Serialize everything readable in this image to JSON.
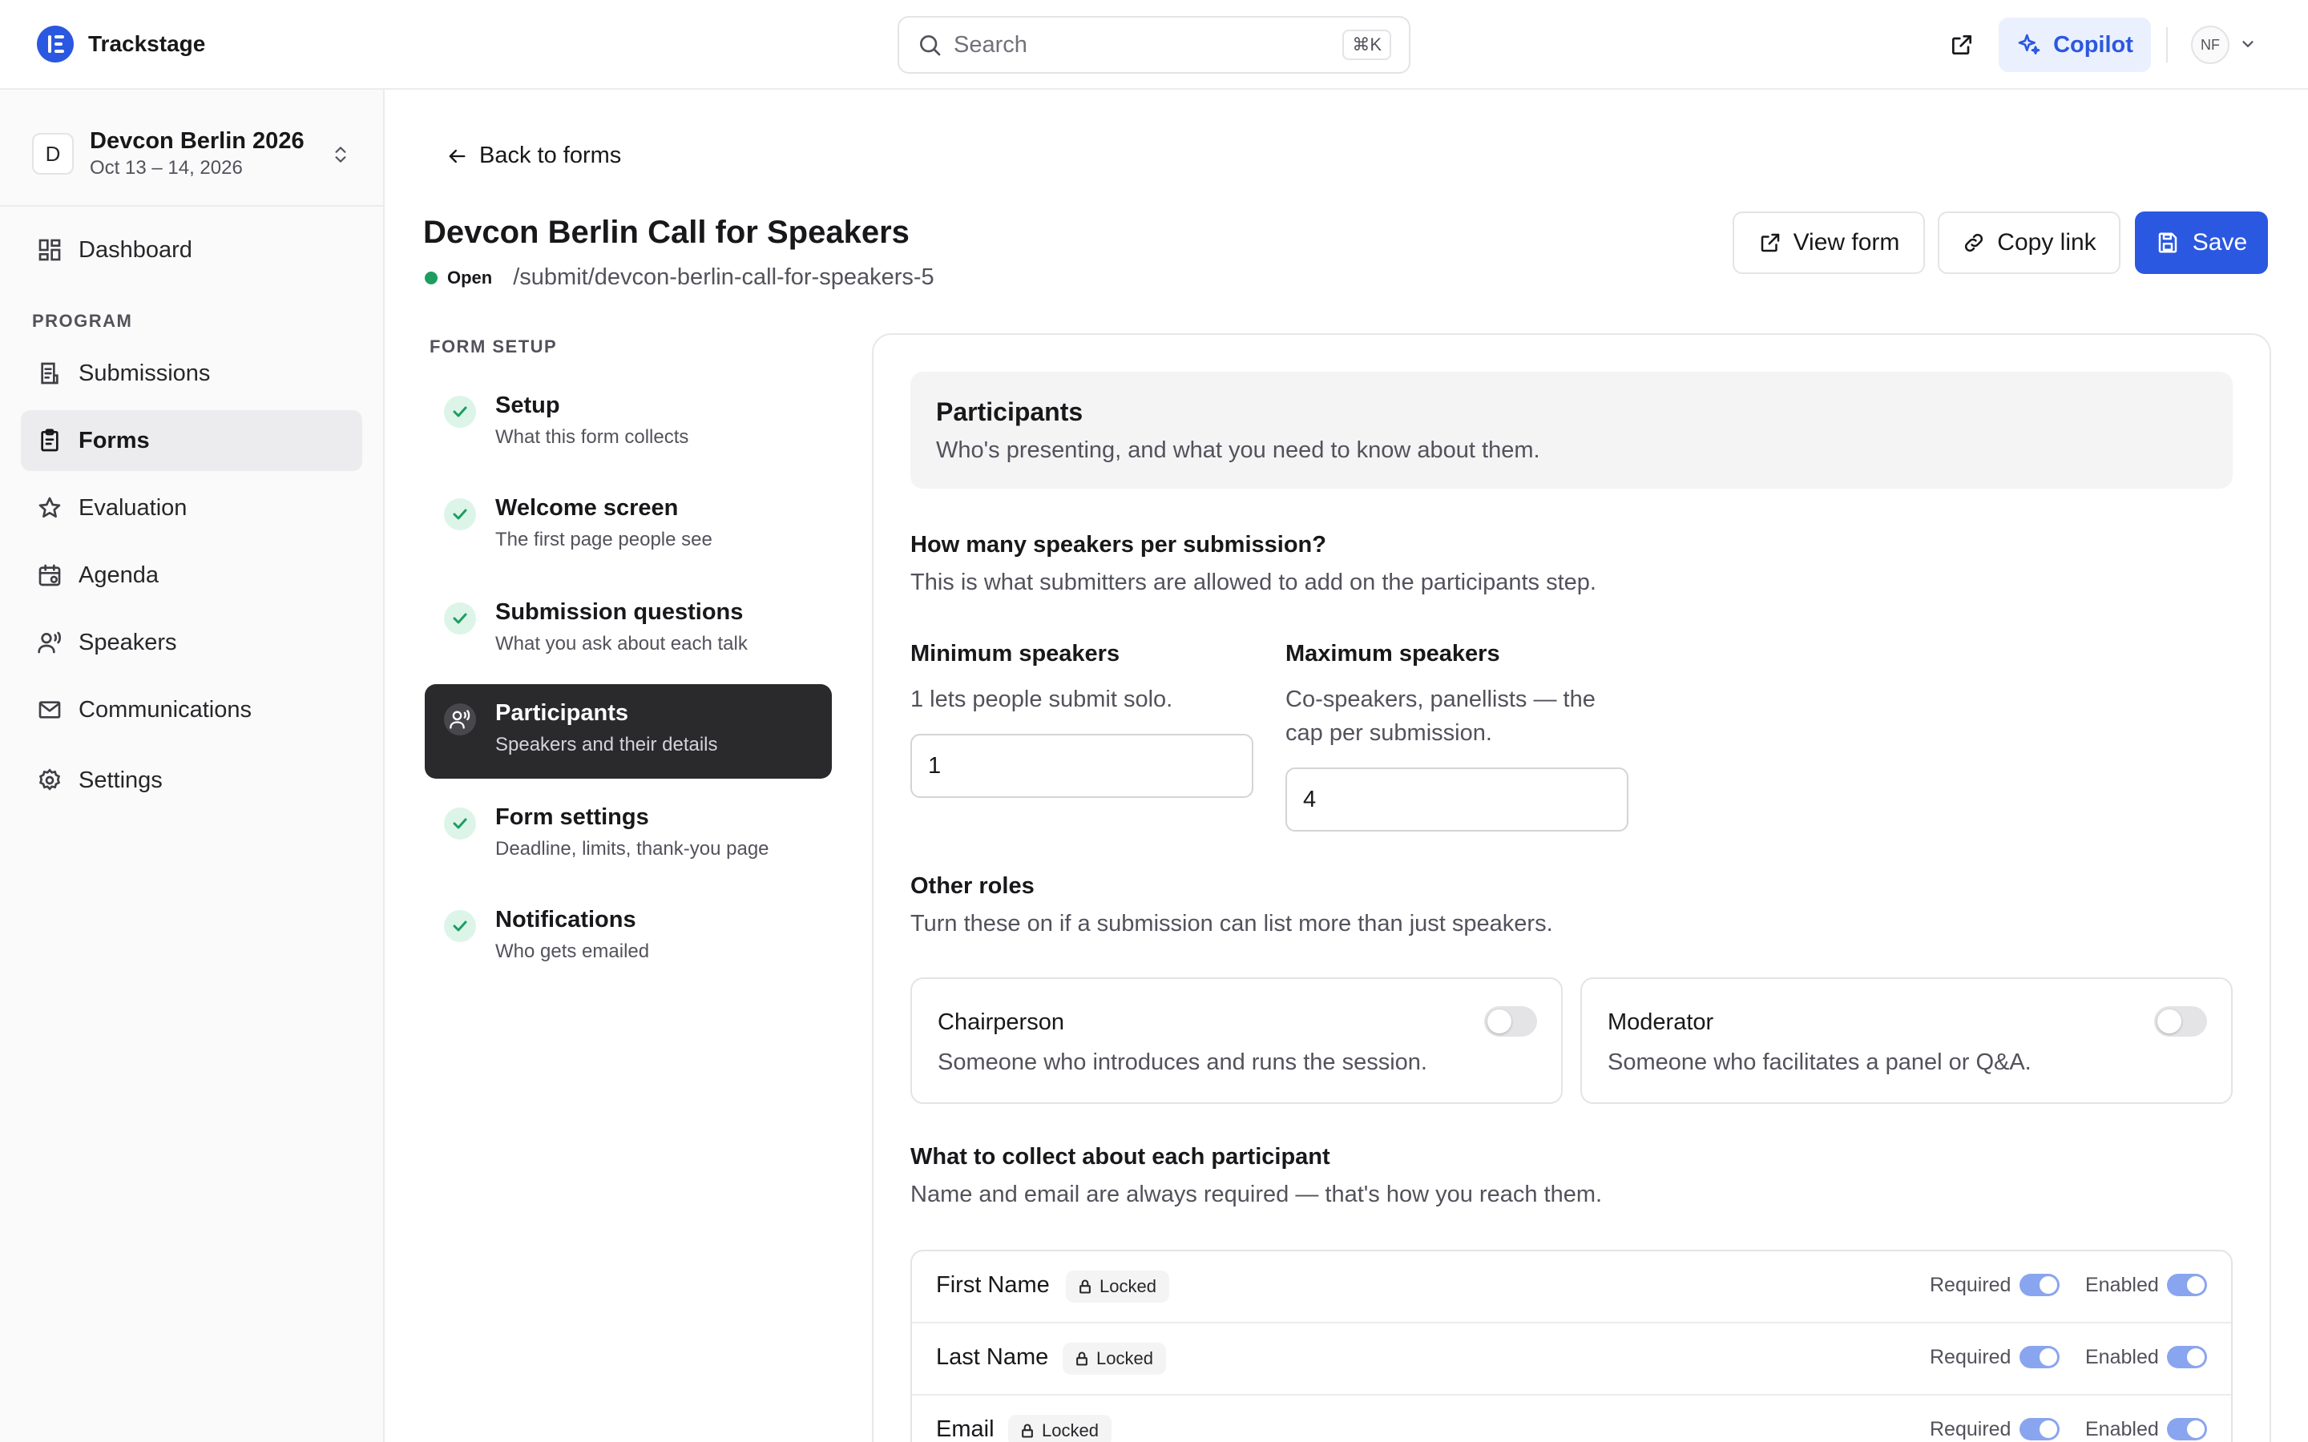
{
  "app": {
    "name": "Trackstage"
  },
  "search": {
    "placeholder": "Search",
    "shortcut": "⌘K"
  },
  "header": {
    "copilot_label": "Copilot",
    "user_initials": "NF"
  },
  "event": {
    "initial": "D",
    "name": "Devcon Berlin 2026",
    "dates": "Oct 13 – 14, 2026"
  },
  "sidebar": {
    "dashboard": "Dashboard",
    "section_label": "PROGRAM",
    "items": [
      {
        "label": "Submissions",
        "icon": "submissions-icon"
      },
      {
        "label": "Forms",
        "icon": "clipboard-icon",
        "active": true
      },
      {
        "label": "Evaluation",
        "icon": "star-icon"
      },
      {
        "label": "Agenda",
        "icon": "calendar-icon"
      },
      {
        "label": "Speakers",
        "icon": "speaker-icon"
      },
      {
        "label": "Communications",
        "icon": "mail-icon"
      },
      {
        "label": "Settings",
        "icon": "gear-icon"
      }
    ]
  },
  "page": {
    "back_label": "Back to forms",
    "title": "Devcon Berlin Call for Speakers",
    "status": "Open",
    "status_color": "#1f9d61",
    "url": "/submit/devcon-berlin-call-for-speakers-5",
    "view_form": "View form",
    "copy_link": "Copy link",
    "save": "Save"
  },
  "steps": {
    "label": "FORM SETUP",
    "items": [
      {
        "title": "Setup",
        "subtitle": "What this form collects",
        "state": "complete"
      },
      {
        "title": "Welcome screen",
        "subtitle": "The first page people see",
        "state": "complete"
      },
      {
        "title": "Submission questions",
        "subtitle": "What you ask about each talk",
        "state": "complete"
      },
      {
        "title": "Participants",
        "subtitle": "Speakers and their details",
        "state": "active"
      },
      {
        "title": "Form settings",
        "subtitle": "Deadline, limits, thank-you page",
        "state": "complete"
      },
      {
        "title": "Notifications",
        "subtitle": "Who gets emailed",
        "state": "complete"
      }
    ]
  },
  "panel": {
    "title": "Participants",
    "subtitle": "Who's presenting, and what you need to know about them.",
    "speakers_q": {
      "title": "How many speakers per submission?",
      "subtitle": "This is what submitters are allowed to add on the participants step."
    },
    "min": {
      "label": "Minimum speakers",
      "help": "1 lets people submit solo.",
      "value": "1"
    },
    "max": {
      "label": "Maximum speakers",
      "help_1": "Co-speakers, panellists — the",
      "help_2": "cap per submission.",
      "value": "4"
    },
    "roles": {
      "title": "Other roles",
      "subtitle": "Turn these on if a submission can list more than just speakers.",
      "items": [
        {
          "title": "Chairperson",
          "subtitle": "Someone who introduces and runs the session.",
          "enabled": false
        },
        {
          "title": "Moderator",
          "subtitle": "Someone who facilitates a panel or Q&A.",
          "enabled": false
        }
      ]
    },
    "collect": {
      "title": "What to collect about each participant",
      "subtitle": "Name and email are always required — that's how you reach them.",
      "locked_label": "Locked",
      "required_label": "Required",
      "enabled_label": "Enabled",
      "fields": [
        {
          "name": "First Name",
          "required": true,
          "enabled": true
        },
        {
          "name": "Last Name",
          "required": true,
          "enabled": true
        },
        {
          "name": "Email",
          "required": true,
          "enabled": true
        }
      ]
    }
  },
  "colors": {
    "accent": "#2b58e0",
    "active_step_bg": "#2a2a2d",
    "check_bg": "#dcf5e8",
    "check": "#1f9d61"
  }
}
